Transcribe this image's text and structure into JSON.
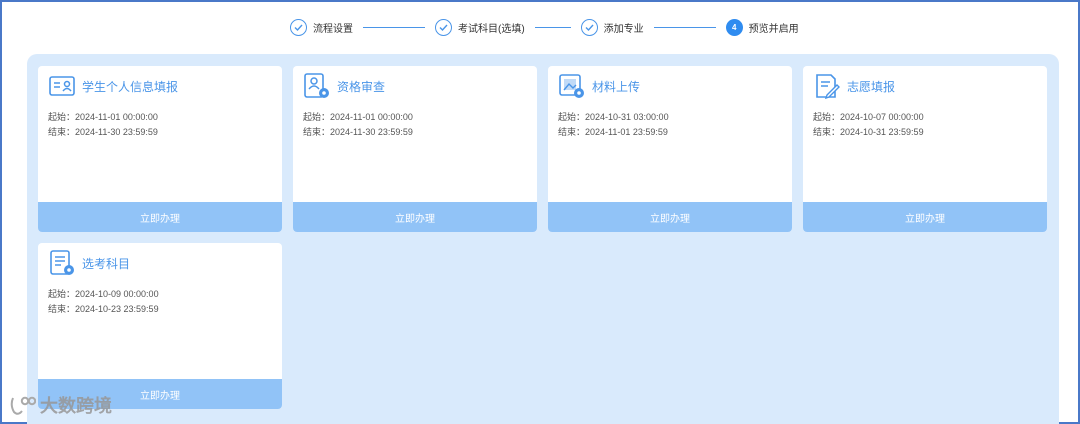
{
  "steps": [
    {
      "label": "流程设置",
      "state": "done"
    },
    {
      "label": "考试科目(选填)",
      "state": "done"
    },
    {
      "label": "添加专业",
      "state": "done"
    },
    {
      "label": "预览并启用",
      "state": "current",
      "number": "4"
    }
  ],
  "cards": [
    {
      "title": "学生个人信息填报",
      "icon": "id-card-icon",
      "start": "起始：2024-11-01 00:00:00",
      "end": "结束：2024-11-30 23:59:59",
      "button": "立即办理"
    },
    {
      "title": "资格审查",
      "icon": "user-gear-icon",
      "start": "起始：2024-11-01 00:00:00",
      "end": "结束：2024-11-30 23:59:59",
      "button": "立即办理"
    },
    {
      "title": "材料上传",
      "icon": "image-upload-icon",
      "start": "起始：2024-10-31 03:00:00",
      "end": "结束：2024-11-01 23:59:59",
      "button": "立即办理"
    },
    {
      "title": "志愿填报",
      "icon": "doc-edit-icon",
      "start": "起始：2024-10-07 00:00:00",
      "end": "结束：2024-10-31 23:59:59",
      "button": "立即办理"
    },
    {
      "title": "选考科目",
      "icon": "doc-gear-icon",
      "start": "起始：2024-10-09 00:00:00",
      "end": "结束：2024-10-23 23:59:59",
      "button": "立即办理"
    }
  ],
  "watermark": {
    "text": "大数跨境"
  },
  "colors": {
    "accent": "#2f8cf0",
    "panel": "#d9eafc",
    "button": "#91c3f7",
    "title": "#4a95e8"
  }
}
